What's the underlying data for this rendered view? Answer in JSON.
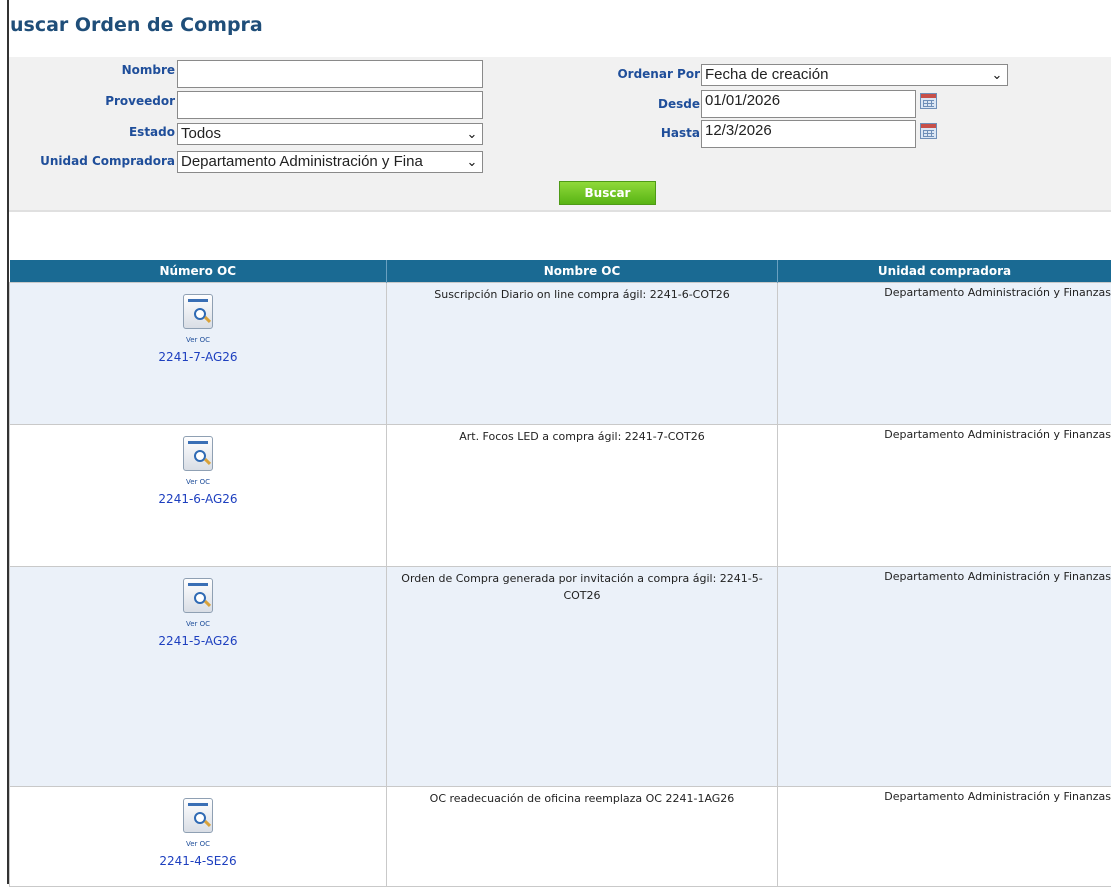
{
  "page": {
    "title": "uscar Orden de Compra"
  },
  "filters": {
    "nombre": {
      "label": "Nombre",
      "value": ""
    },
    "proveedor": {
      "label": "Proveedor",
      "value": ""
    },
    "estado": {
      "label": "Estado",
      "value": "Todos"
    },
    "unidad": {
      "label": "Unidad Compradora",
      "value": "Departamento Administración y Fina"
    },
    "ordenar": {
      "label": "Ordenar Por",
      "value": "Fecha de creación"
    },
    "desde": {
      "label": "Desde",
      "value": "01/01/2026"
    },
    "hasta": {
      "label": "Hasta",
      "value": "12/3/2026"
    },
    "buscar_label": "Buscar"
  },
  "table": {
    "columns": [
      "Número OC",
      "Nombre OC",
      "Unidad compradora"
    ],
    "rows": [
      {
        "ver_label": "Ver OC",
        "numero": "2241-7-AG26",
        "nombre": "Suscripción Diario on line compra ágil: 2241-6-COT26",
        "unidad": "Departamento Administración y Finanzas"
      },
      {
        "ver_label": "Ver OC",
        "numero": "2241-6-AG26",
        "nombre": "Art. Focos LED a compra ágil: 2241-7-COT26",
        "unidad": "Departamento Administración y Finanzas"
      },
      {
        "ver_label": "Ver OC",
        "numero": "2241-5-AG26",
        "nombre": "Orden de Compra generada por invitación a compra ágil: 2241-5-COT26",
        "unidad": "Departamento Administración y Finanzas"
      },
      {
        "ver_label": "Ver OC",
        "numero": "2241-4-SE26",
        "nombre": "OC readecuación de oficina reemplaza OC 2241-1AG26",
        "unidad": "Departamento Administración y Finanzas"
      }
    ]
  },
  "colors": {
    "header_bg": "#1a6a93",
    "title": "#1f4e79",
    "label": "#1f4e9a",
    "button": "#6cc524",
    "link": "#1d3fbf",
    "row_alt": "#ebf1f9"
  },
  "icons": {
    "calendar": "calendar-icon",
    "view_doc": "view-document-icon",
    "dropdown": "chevron-down-icon"
  }
}
